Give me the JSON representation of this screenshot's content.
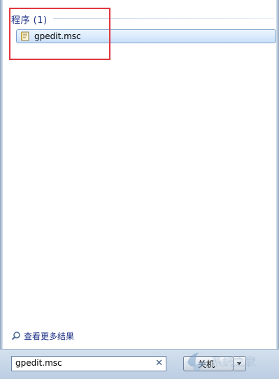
{
  "results": {
    "section_title": "程序 (1)",
    "items": [
      {
        "label": "gpedit.msc",
        "icon": "msc-file-icon"
      }
    ]
  },
  "more_results": {
    "label": "查看更多结果",
    "icon": "search-icon"
  },
  "search": {
    "value": "gpedit.msc",
    "clear_icon": "clear-x-icon"
  },
  "shutdown": {
    "label": "关机"
  },
  "watermark": {
    "text": "系统之家"
  },
  "colors": {
    "header_text": "#1e3287",
    "highlight_border": "#e0383e",
    "item_selected": "#dcebfc"
  }
}
